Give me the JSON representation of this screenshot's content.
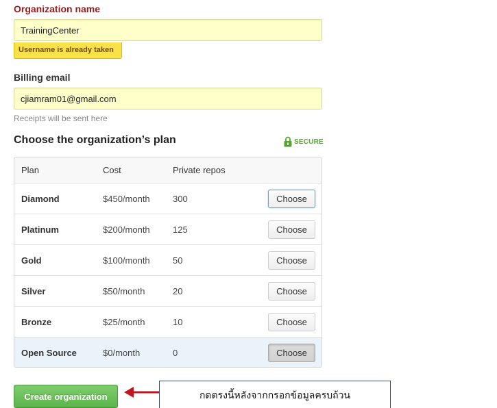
{
  "organization": {
    "label": "Organization name",
    "value": "TrainingCenter",
    "error": "Username is already taken"
  },
  "billing": {
    "label": "Billing email",
    "value": "cjiamram01@gmail.com",
    "hint": "Receipts will be sent here"
  },
  "plan_section": {
    "title": "Choose the organization’s plan",
    "secure_label": "SECURE",
    "columns": [
      "Plan",
      "Cost",
      "Private repos"
    ],
    "rows": [
      {
        "plan": "Diamond",
        "cost": "$450/month",
        "repos": "300",
        "button": "Choose"
      },
      {
        "plan": "Platinum",
        "cost": "$200/month",
        "repos": "125",
        "button": "Choose"
      },
      {
        "plan": "Gold",
        "cost": "$100/month",
        "repos": "50",
        "button": "Choose"
      },
      {
        "plan": "Silver",
        "cost": "$50/month",
        "repos": "20",
        "button": "Choose"
      },
      {
        "plan": "Bronze",
        "cost": "$25/month",
        "repos": "10",
        "button": "Choose"
      },
      {
        "plan": "Open Source",
        "cost": "$0/month",
        "repos": "0",
        "button": "Choose"
      }
    ]
  },
  "create_button": "Create organization",
  "annotation": "กดตรงนี้หลังจากกรอกข้อมูลครบถ้วน",
  "colors": {
    "error_label": "#9b1a1a",
    "input_bg": "#ffffc9",
    "error_badge": "#f8e248",
    "secure_green": "#55a532",
    "create_green": "#5bb44b",
    "selected_row": "#eaf2fa",
    "arrow_red": "#c0161f"
  }
}
